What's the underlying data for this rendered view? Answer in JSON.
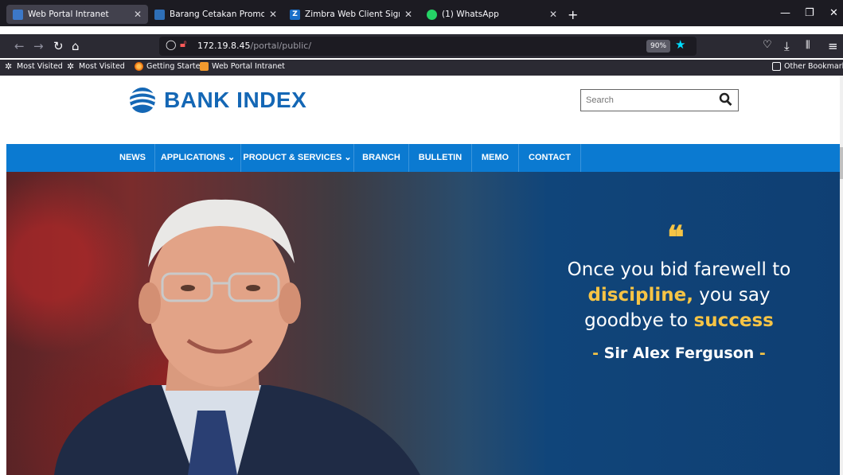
{
  "browser": {
    "tabs": [
      {
        "title": "Web Portal Intranet",
        "active": true
      },
      {
        "title": "Barang Cetakan Promosi"
      },
      {
        "title": "Zimbra Web Client Sign In"
      },
      {
        "title": "(1) WhatsApp"
      }
    ],
    "url_host": "172.19.8.45",
    "url_path": "/portal/public/",
    "zoom": "90%",
    "bookmarks": [
      "Most Visited",
      "Most Visited",
      "Getting Started",
      "Web Portal Intranet"
    ],
    "other_bookmarks": "Other Bookmarks"
  },
  "site": {
    "logo_text": "BANK INDE",
    "logo_x": "X",
    "search_placeholder": "Search",
    "menu": [
      "NEWS",
      "APPLICATIONS",
      "PRODUCT & SERVICES",
      "BRANCH",
      "BULLETIN",
      "MEMO",
      "CONTACT"
    ],
    "menu_dropdown_suffix": " ⌄"
  },
  "hero": {
    "quote_mark": "❝",
    "quote_part1": "Once you bid farewell to",
    "quote_hl1": "discipline,",
    "quote_part2": " you say",
    "quote_part3": "goodbye to ",
    "quote_hl2": "success",
    "author_dash_left": "- ",
    "author": "Sir Alex Ferguson",
    "author_dash_right": " -"
  },
  "colors": {
    "brand_blue": "#1467b5",
    "menu_blue": "#0b7ad1",
    "accent_gold": "#f6c445"
  }
}
